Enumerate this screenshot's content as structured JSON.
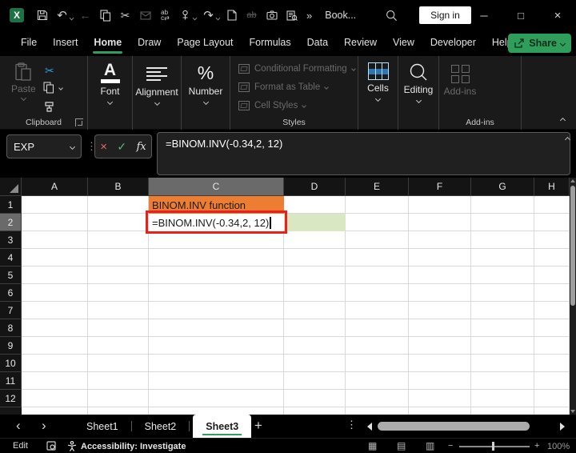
{
  "colors": {
    "accent_green": "#2E9E63",
    "share_green": "#2F9E5B",
    "orange_fill": "#ED7D31",
    "green_fill": "#D9E7C3",
    "annotation_red": "#E8211D",
    "header_selected_gray": "#6A6A6A",
    "cut_blue": "#2E9BD6",
    "cells_blue": "#2E75B6",
    "cancel_red": "#E06A65",
    "enter_green": "#58B87F"
  },
  "titlebar": {
    "title": "Book...",
    "sign_in": "Sign in",
    "overflow": "»",
    "quick_access": [
      {
        "name": "save-icon",
        "disabled": false,
        "chevron": false
      },
      {
        "name": "undo-icon",
        "disabled": false,
        "chevron": true
      },
      {
        "name": "back-icon",
        "disabled": true,
        "chevron": false
      },
      {
        "name": "copy-icon",
        "disabled": false,
        "chevron": false
      },
      {
        "name": "cut-icon",
        "disabled": false,
        "chevron": false
      },
      {
        "name": "mail-icon",
        "disabled": true,
        "chevron": false
      },
      {
        "name": "replace-icon",
        "disabled": false,
        "chevron": false
      },
      {
        "name": "touch-mode-icon",
        "disabled": false,
        "chevron": true
      },
      {
        "name": "redo-icon",
        "disabled": false,
        "chevron": true
      },
      {
        "name": "new-file-icon",
        "disabled": false,
        "chevron": false
      },
      {
        "name": "strikethrough-icon",
        "disabled": true,
        "chevron": false
      },
      {
        "name": "camera-icon",
        "disabled": false,
        "chevron": false
      },
      {
        "name": "preview-icon",
        "disabled": false,
        "chevron": false
      }
    ]
  },
  "ribbon_tabs": {
    "tabs": [
      "File",
      "Insert",
      "Home",
      "Draw",
      "Page Layout",
      "Formulas",
      "Data",
      "Review",
      "View",
      "Developer",
      "Help"
    ],
    "active": "Home",
    "share_label": "Share"
  },
  "ribbon": {
    "paste_label": "Paste",
    "group_labels": {
      "clipboard": "Clipboard",
      "font": "Font",
      "alignment": "Alignment",
      "number": "Number",
      "styles": "Styles",
      "cells": "Cells",
      "editing": "Editing",
      "addins": "Add-ins",
      "addins_group": "Add-ins"
    },
    "styles_items": [
      "Conditional Formatting",
      "Format as Table",
      "Cell Styles"
    ]
  },
  "formula_bar": {
    "name_box_value": "EXP",
    "formula": "=BINOM.INV(-0.34,2, 12)"
  },
  "grid": {
    "columns": [
      "A",
      "B",
      "C",
      "D",
      "E",
      "F",
      "G",
      "H"
    ],
    "rows": [
      "1",
      "2",
      "3",
      "4",
      "5",
      "6",
      "7",
      "8",
      "9",
      "10",
      "11",
      "12"
    ],
    "selected_column": "C",
    "selected_row": "2",
    "cells": {
      "C1": {
        "text": "BINOM.INV function"
      },
      "C2": {
        "text": "=BINOM.INV(-0.34,2, 12)"
      },
      "D2": {
        "text": ""
      }
    }
  },
  "sheet_bar": {
    "tabs": [
      "Sheet1",
      "Sheet2",
      "Sheet3"
    ],
    "active": "Sheet3"
  },
  "status_bar": {
    "mode": "Edit",
    "accessibility": "Accessibility: Investigate",
    "zoom_level": "100%"
  }
}
